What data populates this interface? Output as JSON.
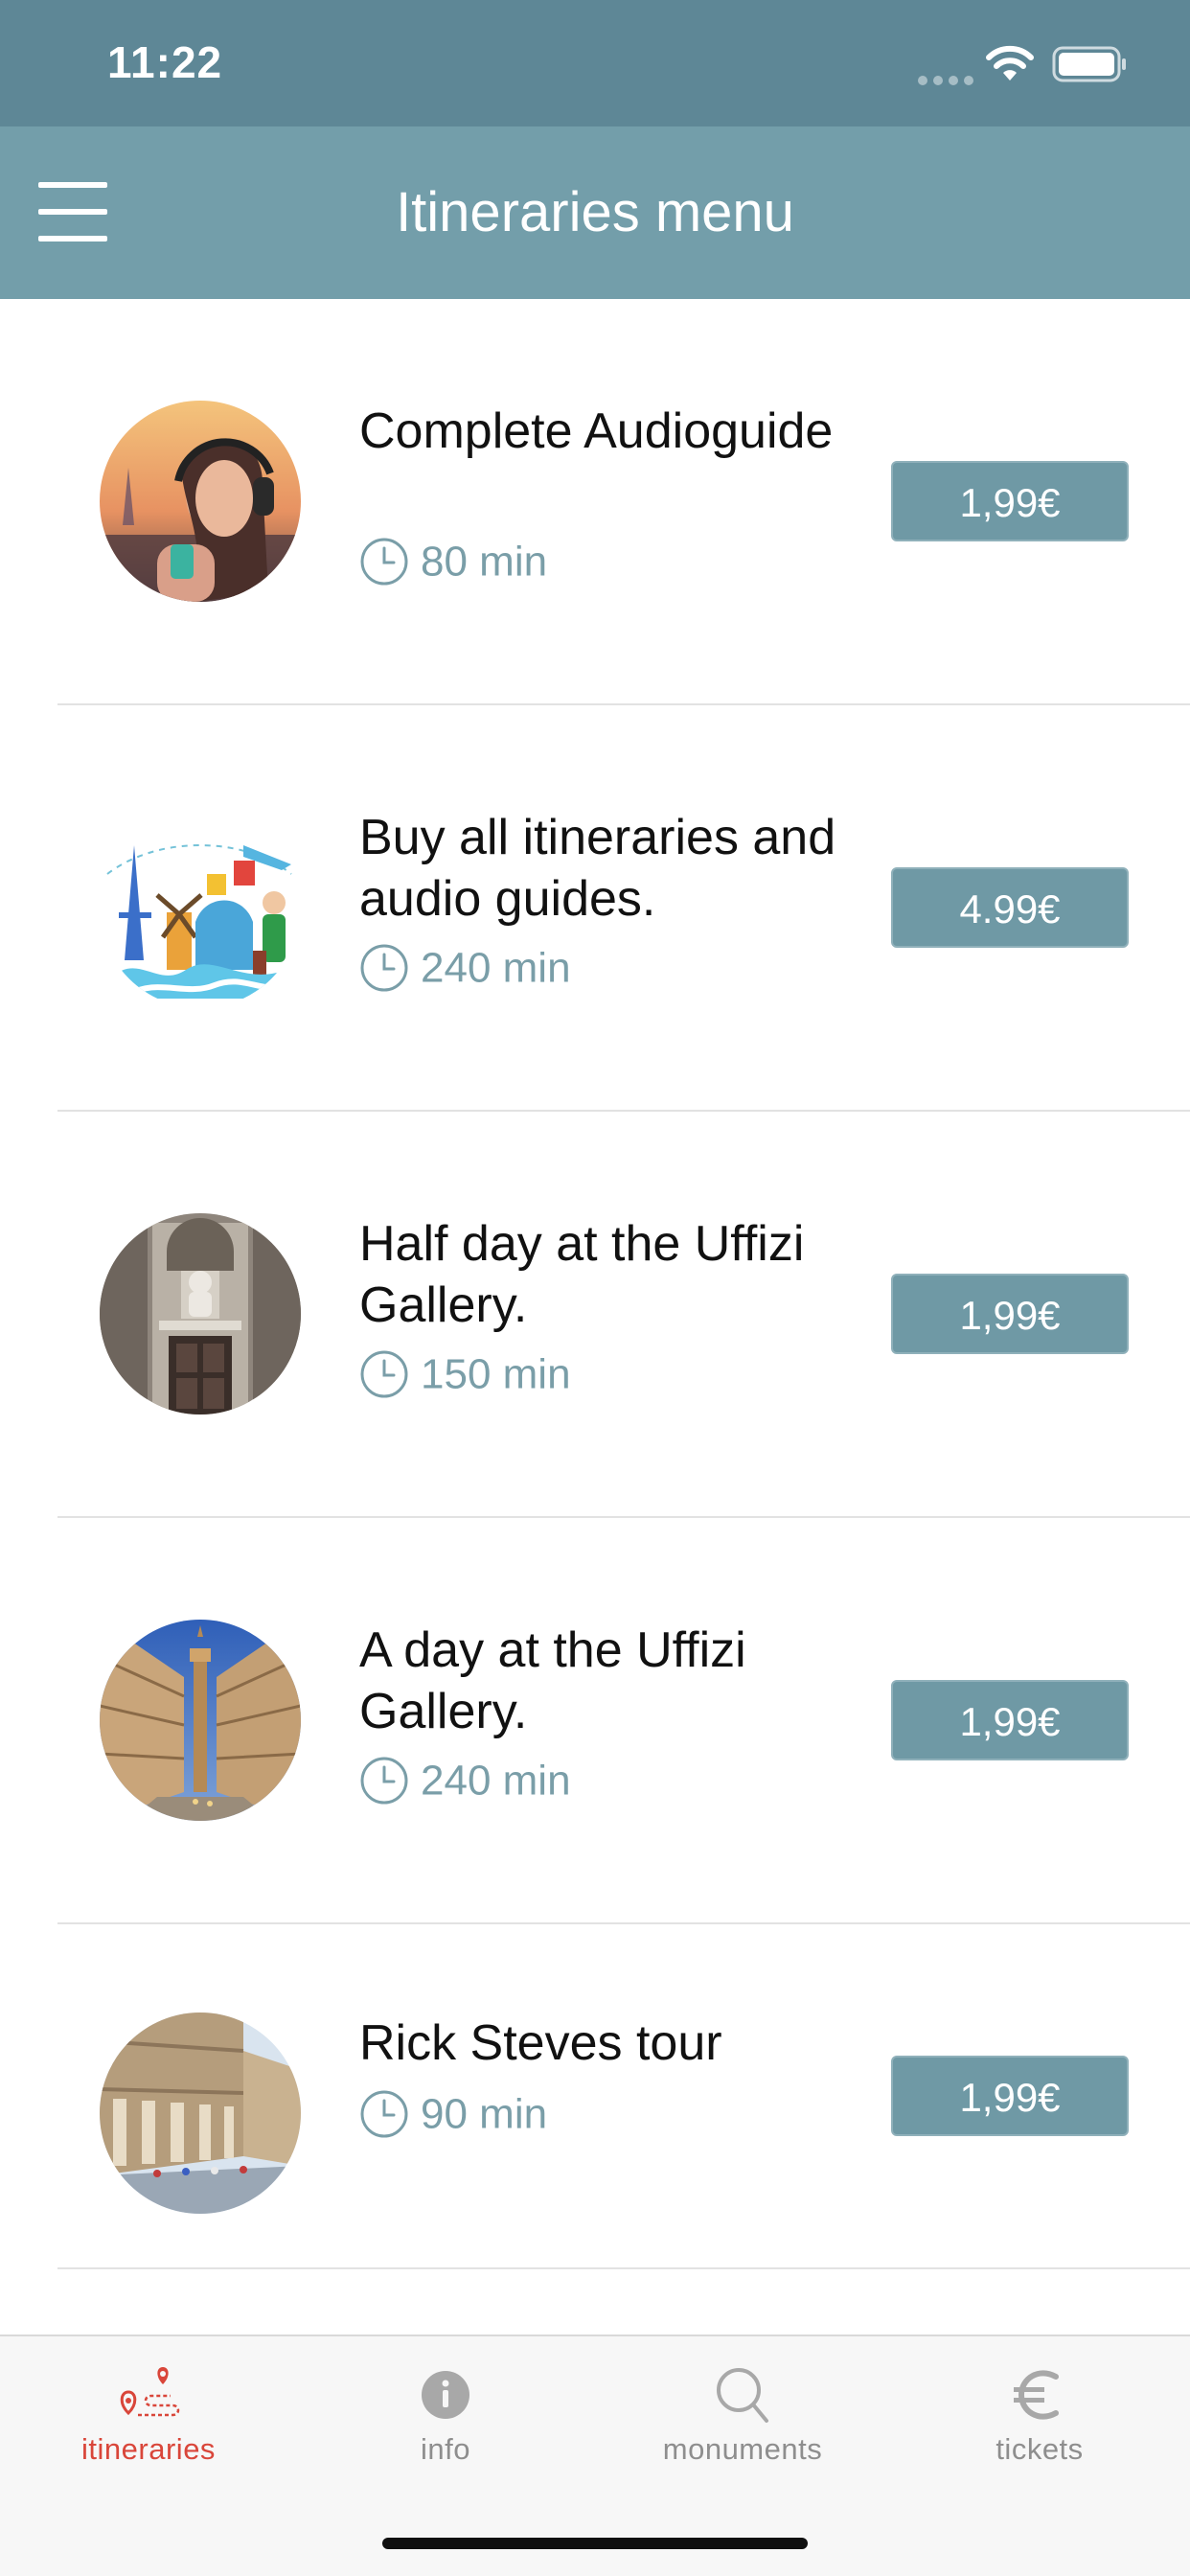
{
  "status_bar": {
    "time": "11:22"
  },
  "nav": {
    "title": "Itineraries menu",
    "menu_icon": "hamburger-menu-icon"
  },
  "itineraries": [
    {
      "title": "Complete Audioguide",
      "duration": "80 min",
      "price": "1,99€",
      "image": "woman-with-headphones-paris-photo"
    },
    {
      "title": "Buy all itineraries and audio guides.",
      "duration": "240 min",
      "price": "4.99€",
      "image": "travel-illustration"
    },
    {
      "title": "Half day at the Uffizi Gallery.",
      "duration": "150 min",
      "price": "1,99€",
      "image": "uffizi-doorway-photo"
    },
    {
      "title": "A day at the Uffizi Gallery.",
      "duration": "240 min",
      "price": "1,99€",
      "image": "uffizi-courtyard-tower-photo"
    },
    {
      "title": "Rick Steves tour",
      "duration": "90 min",
      "price": "1,99€",
      "image": "uffizi-colonnade-photo"
    }
  ],
  "tab_bar": {
    "tabs": [
      {
        "label": "itineraries",
        "icon": "route-pin-icon",
        "active": true
      },
      {
        "label": "info",
        "icon": "info-icon",
        "active": false
      },
      {
        "label": "monuments",
        "icon": "search-icon",
        "active": false
      },
      {
        "label": "tickets",
        "icon": "euro-icon",
        "active": false
      }
    ]
  },
  "colors": {
    "status_bar": "#5e8796",
    "nav_bar": "#739eaa",
    "price_button": "#6f99a5",
    "duration_text": "#7a9ea8",
    "active_tab": "#d9463a"
  }
}
